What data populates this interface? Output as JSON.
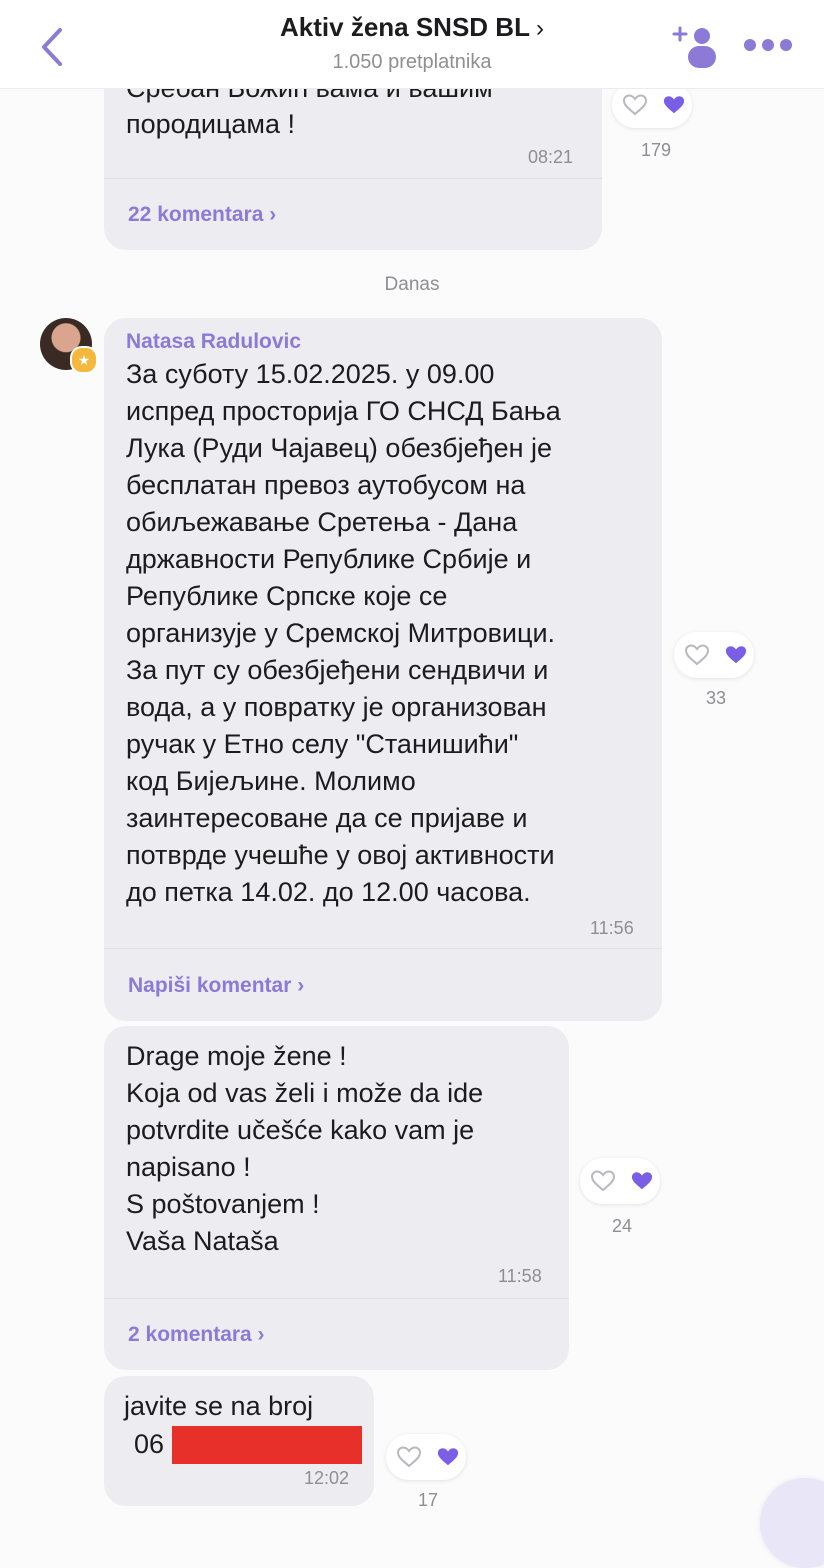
{
  "header": {
    "title": "Aktiv žena SNSD BL",
    "title_chevron": "›",
    "subscribers": "1.050 pretplatnika",
    "back_icon": "chevron-left-icon",
    "add_member_icon": "add-member-icon",
    "more_icon": "more-dots-icon",
    "accent_color": "#8c7ad6"
  },
  "date_separator": "Danas",
  "messages": [
    {
      "text_top_partial": "Сребан Божић вама и вашим",
      "text": "породицама !",
      "time": "08:21",
      "comments": "22 komentara ›",
      "reactions_count": "179"
    },
    {
      "sender": "Natasa Radulovic",
      "text": "За суботу 15.02.2025. у 09.00\nиспред просторија ГО СНСД Бања\nЛука (Руди Чајавец) обезбјеђен је\nбесплатан превоз аутобусом на\nобиљежавање Сретења - Дана\nдржавности Републике Србије и\nРепублике Српске које се\nорганизује у Сремској Митровици.\nЗа пут су обезбјеђени сендвичи и\nвода, а у повратку је организован\nручак у Етно селу \"Станишићи\"\nкод Бијељине. Молимо\nзаинтересоване да се пријаве и\nпотврде учешће у овој активности\nдо петка 14.02. до 12.00 часова.",
      "time": "11:56",
      "comments": "Napiši komentar ›",
      "reactions_count": "33"
    },
    {
      "text": "Drage moje žene !\nKoja od vas želi i može da ide\npotvrdite učešće kako vam je\nnapisano !\nS poštovanjem !\nVaša Nataša",
      "time": "11:58",
      "comments": "2 komentara ›",
      "reactions_count": "24"
    },
    {
      "text_line1": "javite se na broj",
      "text_line2": "06",
      "time": "12:02",
      "reactions_count": "17"
    }
  ],
  "colors": {
    "heart_filled": "#7b5ee6",
    "redaction": "#e8302a",
    "bubble": "#ededf1"
  }
}
